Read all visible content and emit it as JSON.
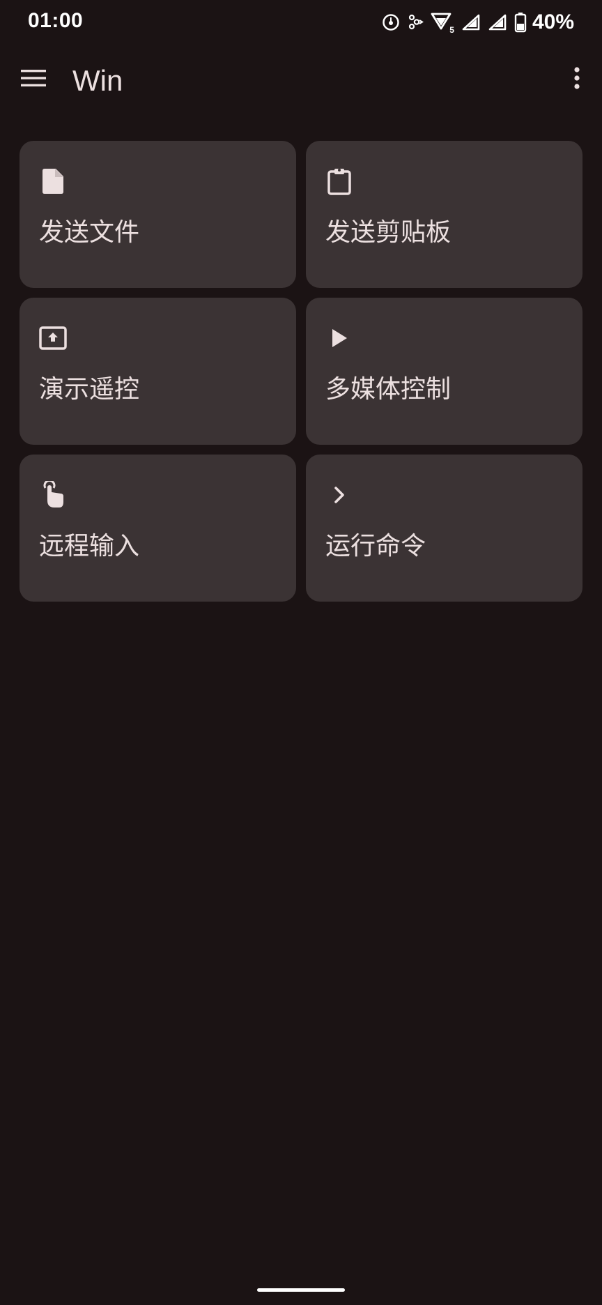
{
  "status_bar": {
    "time": "01:00",
    "battery_percent": "40%",
    "icons": [
      "timer-icon",
      "pawprint-icon",
      "wifi-icon",
      "signal-icon",
      "signal-icon",
      "battery-icon"
    ],
    "wifi_badge": "5"
  },
  "app_bar": {
    "title": "Win",
    "menu_icon": "hamburger-menu-icon",
    "overflow_icon": "more-vert-icon"
  },
  "actions": [
    {
      "label": "发送文件",
      "icon": "file-icon"
    },
    {
      "label": "发送剪贴板",
      "icon": "clipboard-icon"
    },
    {
      "label": "演示遥控",
      "icon": "presentation-icon"
    },
    {
      "label": "多媒体控制",
      "icon": "play-icon"
    },
    {
      "label": "远程输入",
      "icon": "touch-icon"
    },
    {
      "label": "运行命令",
      "icon": "chevron-right-icon"
    }
  ],
  "colors": {
    "background": "#1b1314",
    "tile": "#3b3334",
    "text": "#ece0e0",
    "icon": "#ece0e0"
  }
}
